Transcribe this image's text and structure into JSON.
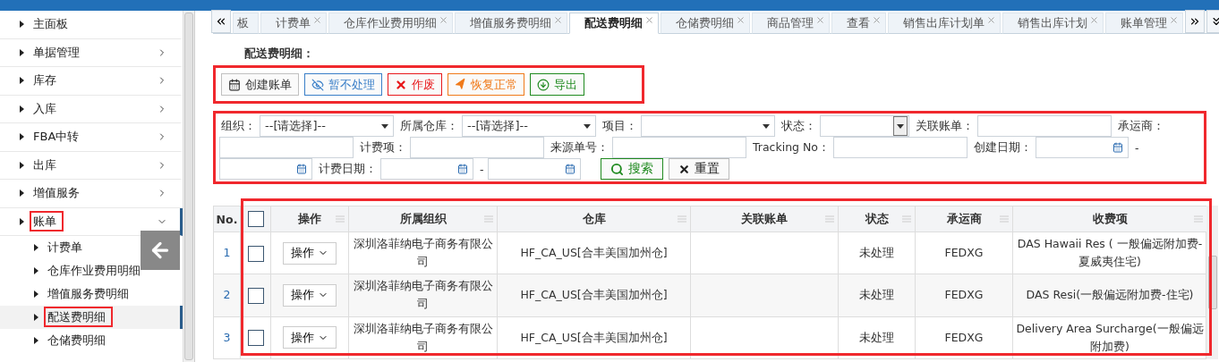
{
  "sidebar": {
    "items": [
      {
        "label": "主面板"
      },
      {
        "label": "单据管理",
        "expanded": false
      },
      {
        "label": "库存",
        "expanded": false
      },
      {
        "label": "入库",
        "expanded": false
      },
      {
        "label": "FBA中转",
        "expanded": false
      },
      {
        "label": "出库",
        "expanded": false
      },
      {
        "label": "增值服务",
        "expanded": false
      },
      {
        "label": "账单",
        "expanded": true,
        "highlighted": true,
        "children": [
          {
            "label": "计费单",
            "selected": false,
            "highlighted": false
          },
          {
            "label": "仓库作业费用明细",
            "selected": false,
            "highlighted": false
          },
          {
            "label": "增值服务费明细",
            "selected": false,
            "highlighted": false
          },
          {
            "label": "配送费明细",
            "selected": true,
            "highlighted": true
          },
          {
            "label": "仓储费明细",
            "selected": false,
            "highlighted": false
          }
        ]
      }
    ]
  },
  "tabs": [
    {
      "label": "板",
      "selected": false,
      "closable": false
    },
    {
      "label": "计费单",
      "selected": false,
      "closable": true
    },
    {
      "label": "仓库作业费用明细",
      "selected": false,
      "closable": true
    },
    {
      "label": "增值服务费明细",
      "selected": false,
      "closable": true
    },
    {
      "label": "配送费明细",
      "selected": true,
      "closable": true
    },
    {
      "label": "仓储费明细",
      "selected": false,
      "closable": true
    },
    {
      "label": "商品管理",
      "selected": false,
      "closable": true
    },
    {
      "label": "查看",
      "selected": false,
      "closable": true
    },
    {
      "label": "销售出库计划单",
      "selected": false,
      "closable": true
    },
    {
      "label": "销售出库计划",
      "selected": false,
      "closable": true
    },
    {
      "label": "账单管理",
      "selected": false,
      "closable": true
    }
  ],
  "panel": {
    "title": "配送费明细：",
    "toolbar": {
      "highlighted": true,
      "buttons": [
        {
          "label": "创建账单",
          "kind": "calendar",
          "color": "#333333"
        },
        {
          "label": "暂不处理",
          "kind": "eye",
          "color": "#3a7fc8"
        },
        {
          "label": "作废",
          "kind": "cross",
          "color": "#e8191c"
        },
        {
          "label": "恢复正常",
          "kind": "arrow",
          "color": "#f07a1a"
        },
        {
          "label": "导出",
          "kind": "download",
          "color": "#1f8a1f"
        }
      ]
    },
    "filters": {
      "highlighted": true,
      "rows": [
        [
          {
            "kind": "label",
            "text": "组织："
          },
          {
            "kind": "select",
            "value": "--[请选择]--"
          },
          {
            "kind": "label",
            "text": "所属仓库："
          },
          {
            "kind": "select",
            "value": "--[请选择]--"
          },
          {
            "kind": "label",
            "text": "项目："
          },
          {
            "kind": "select"
          },
          {
            "kind": "label",
            "text": "状态："
          },
          {
            "kind": "combo"
          },
          {
            "kind": "label",
            "text": "关联账单："
          },
          {
            "kind": "input"
          },
          {
            "kind": "label",
            "text": "承运商："
          }
        ],
        [
          {
            "kind": "input"
          },
          {
            "kind": "label",
            "text": "计费项："
          },
          {
            "kind": "input"
          },
          {
            "kind": "label",
            "text": "来源单号："
          },
          {
            "kind": "input"
          },
          {
            "kind": "label",
            "text": "Tracking No："
          },
          {
            "kind": "input"
          },
          {
            "kind": "label",
            "text": "创建日期："
          },
          {
            "kind": "date"
          },
          {
            "kind": "label",
            "text": "-"
          }
        ],
        [
          {
            "kind": "date"
          },
          {
            "kind": "label",
            "text": "计费日期："
          },
          {
            "kind": "date"
          },
          {
            "kind": "label",
            "text": "-"
          },
          {
            "kind": "date"
          },
          {
            "kind": "search",
            "text": "搜索"
          },
          {
            "kind": "reset",
            "text": "重置"
          }
        ]
      ]
    },
    "table": {
      "highlighted": true,
      "all_checked": false,
      "columns": [
        "No.",
        "",
        "操作",
        "所属组织",
        "仓库",
        "关联账单",
        "状态",
        "承运商",
        "收费项"
      ],
      "rows": [
        {
          "no": "1",
          "checked": false,
          "action": "操作",
          "org": "深圳洛菲纳电子商务有限公司",
          "warehouse": "HF_CA_US[合丰美国加州仓]",
          "status": "未处理",
          "carrier": "FEDXG",
          "fee": "DAS Hawaii Res ( 一般偏远附加费-夏威夷住宅)"
        },
        {
          "no": "2",
          "checked": false,
          "action": "操作",
          "org": "深圳洛菲纳电子商务有限公司",
          "warehouse": "HF_CA_US[合丰美国加州仓]",
          "status": "未处理",
          "carrier": "FEDXG",
          "fee": "DAS Resi(一般偏远附加费-住宅)"
        },
        {
          "no": "3",
          "checked": false,
          "action": "操作",
          "org": "深圳洛菲纳电子商务有限公司",
          "warehouse": "HF_CA_US[合丰美国加州仓]",
          "status": "未处理",
          "carrier": "FEDXG",
          "fee": "Delivery Area Surcharge(一般偏远附加费)"
        }
      ]
    }
  }
}
